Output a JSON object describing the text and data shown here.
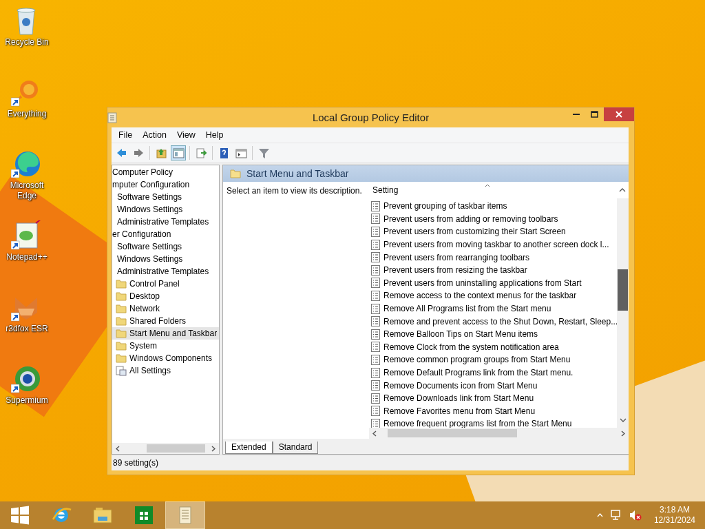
{
  "desktop_icons": [
    {
      "label": "Recycle Bin",
      "kind": "recycle",
      "shortcut": false
    },
    {
      "label": "Everything",
      "kind": "everything",
      "shortcut": true
    },
    {
      "label": "Microsoft Edge",
      "kind": "edge",
      "shortcut": true
    },
    {
      "label": "Notepad++",
      "kind": "notepad",
      "shortcut": true
    },
    {
      "label": "r3dfox ESR",
      "kind": "fox",
      "shortcut": true
    },
    {
      "label": "Supermium",
      "kind": "supermium",
      "shortcut": true
    }
  ],
  "window": {
    "title": "Local Group Policy Editor",
    "menu": [
      "File",
      "Action",
      "View",
      "Help"
    ],
    "toolbar": [
      [
        {
          "kind": "back",
          "pressed": false
        },
        {
          "kind": "forward",
          "pressed": false
        }
      ],
      [
        {
          "kind": "up",
          "pressed": false
        },
        {
          "kind": "tree",
          "pressed": true
        }
      ],
      [
        {
          "kind": "export",
          "pressed": false
        }
      ],
      [
        {
          "kind": "help",
          "pressed": false
        },
        {
          "kind": "pane",
          "pressed": false
        }
      ],
      [
        {
          "kind": "filter",
          "pressed": false
        }
      ]
    ],
    "tree": [
      {
        "label": "Computer Policy",
        "selected": false,
        "children": [
          {
            "label": "mputer Configuration",
            "selected": false,
            "children": [
              {
                "label": "Software Settings",
                "selected": false
              },
              {
                "label": "Windows Settings",
                "selected": false
              },
              {
                "label": "Administrative Templates",
                "selected": false
              }
            ]
          },
          {
            "label": "er Configuration",
            "selected": false,
            "children": [
              {
                "label": "Software Settings",
                "selected": false
              },
              {
                "label": "Windows Settings",
                "selected": false
              },
              {
                "label": "Administrative Templates",
                "selected": false,
                "children": [
                  {
                    "label": "Control Panel",
                    "kind": "folder",
                    "selected": false
                  },
                  {
                    "label": "Desktop",
                    "kind": "folder",
                    "selected": false
                  },
                  {
                    "label": "Network",
                    "kind": "folder",
                    "selected": false
                  },
                  {
                    "label": "Shared Folders",
                    "kind": "folder",
                    "selected": false
                  },
                  {
                    "label": "Start Menu and Taskbar",
                    "kind": "folder",
                    "selected": true
                  },
                  {
                    "label": "System",
                    "kind": "folder",
                    "selected": false
                  },
                  {
                    "label": "Windows Components",
                    "kind": "folder",
                    "selected": false
                  },
                  {
                    "label": "All Settings",
                    "kind": "settings",
                    "selected": false
                  }
                ]
              }
            ]
          }
        ]
      }
    ],
    "header": "Start Menu and Taskbar",
    "description": "Select an item to view its description.",
    "column": "Setting",
    "settings": [
      "Prevent grouping of taskbar items",
      "Prevent users from adding or removing toolbars",
      "Prevent users from customizing their Start Screen",
      "Prevent users from moving taskbar to another screen dock l...",
      "Prevent users from rearranging toolbars",
      "Prevent users from resizing the taskbar",
      "Prevent users from uninstalling applications from Start",
      "Remove access to the context menus for the taskbar",
      "Remove All Programs list from the Start menu",
      "Remove and prevent access to the Shut Down, Restart, Sleep...",
      "Remove Balloon Tips on Start Menu items",
      "Remove Clock from the system notification area",
      "Remove common program groups from Start Menu",
      "Remove Default Programs link from the Start menu.",
      "Remove Documents icon from Start Menu",
      "Remove Downloads link from Start Menu",
      "Remove Favorites menu from Start Menu",
      "Remove frequent programs list from the Start Menu"
    ],
    "tabs": [
      {
        "label": "Extended",
        "selected": true
      },
      {
        "label": "Standard",
        "selected": false
      }
    ],
    "status": "89 setting(s)"
  },
  "taskbar": {
    "apps": [
      {
        "kind": "ie",
        "selected": false
      },
      {
        "kind": "explorer",
        "selected": false
      },
      {
        "kind": "store",
        "selected": false
      },
      {
        "kind": "gpedit",
        "selected": true
      }
    ],
    "time": "3:18 AM",
    "date": "12/31/2024"
  }
}
